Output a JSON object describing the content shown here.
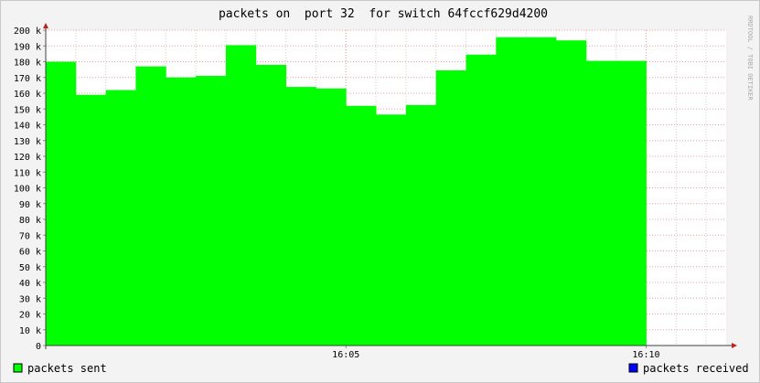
{
  "chart_data": {
    "type": "area",
    "title": "packets on  port 32  for switch 64fccf629d4200",
    "watermark": "RRDTOOL / TOBI OETIKER",
    "ylim": [
      0,
      200000
    ],
    "y_ticks": [
      0,
      10000,
      20000,
      30000,
      40000,
      50000,
      60000,
      70000,
      80000,
      90000,
      100000,
      110000,
      120000,
      130000,
      140000,
      150000,
      160000,
      170000,
      180000,
      190000,
      200000
    ],
    "y_tick_labels": [
      "0",
      "10 k",
      "20 k",
      "30 k",
      "40 k",
      "50 k",
      "60 k",
      "70 k",
      "80 k",
      "90 k",
      "100 k",
      "110 k",
      "120 k",
      "130 k",
      "140 k",
      "150 k",
      "160 k",
      "170 k",
      "180 k",
      "190 k",
      "200 k"
    ],
    "x_range": [
      "16:00:00",
      "16:11:20"
    ],
    "x_ticks": [
      {
        "time": "16:05",
        "label": "16:05"
      },
      {
        "time": "16:10",
        "label": "16:10"
      }
    ],
    "grid": true,
    "legend_position": "bottom",
    "series": [
      {
        "name": "packets sent",
        "color": "#00ff00",
        "points": [
          {
            "start": "16:00:00",
            "end": "16:00:30",
            "value": 180000
          },
          {
            "start": "16:00:30",
            "end": "16:01:00",
            "value": 159000
          },
          {
            "start": "16:01:00",
            "end": "16:01:30",
            "value": 162000
          },
          {
            "start": "16:01:30",
            "end": "16:02:00",
            "value": 177000
          },
          {
            "start": "16:02:00",
            "end": "16:02:30",
            "value": 170000
          },
          {
            "start": "16:02:30",
            "end": "16:03:00",
            "value": 171000
          },
          {
            "start": "16:03:00",
            "end": "16:03:30",
            "value": 190500
          },
          {
            "start": "16:03:30",
            "end": "16:04:00",
            "value": 178000
          },
          {
            "start": "16:04:00",
            "end": "16:04:30",
            "value": 164000
          },
          {
            "start": "16:04:30",
            "end": "16:05:00",
            "value": 163000
          },
          {
            "start": "16:05:00",
            "end": "16:05:30",
            "value": 152000
          },
          {
            "start": "16:05:30",
            "end": "16:06:00",
            "value": 146500
          },
          {
            "start": "16:06:00",
            "end": "16:06:30",
            "value": 152500
          },
          {
            "start": "16:06:30",
            "end": "16:07:00",
            "value": 174500
          },
          {
            "start": "16:07:00",
            "end": "16:07:30",
            "value": 184500
          },
          {
            "start": "16:07:30",
            "end": "16:08:00",
            "value": 195500
          },
          {
            "start": "16:08:00",
            "end": "16:08:30",
            "value": 195500
          },
          {
            "start": "16:08:30",
            "end": "16:09:00",
            "value": 193500
          },
          {
            "start": "16:09:00",
            "end": "16:10:00",
            "value": 180500
          }
        ]
      },
      {
        "name": "packets received",
        "color": "#0000ff",
        "points": []
      }
    ]
  }
}
